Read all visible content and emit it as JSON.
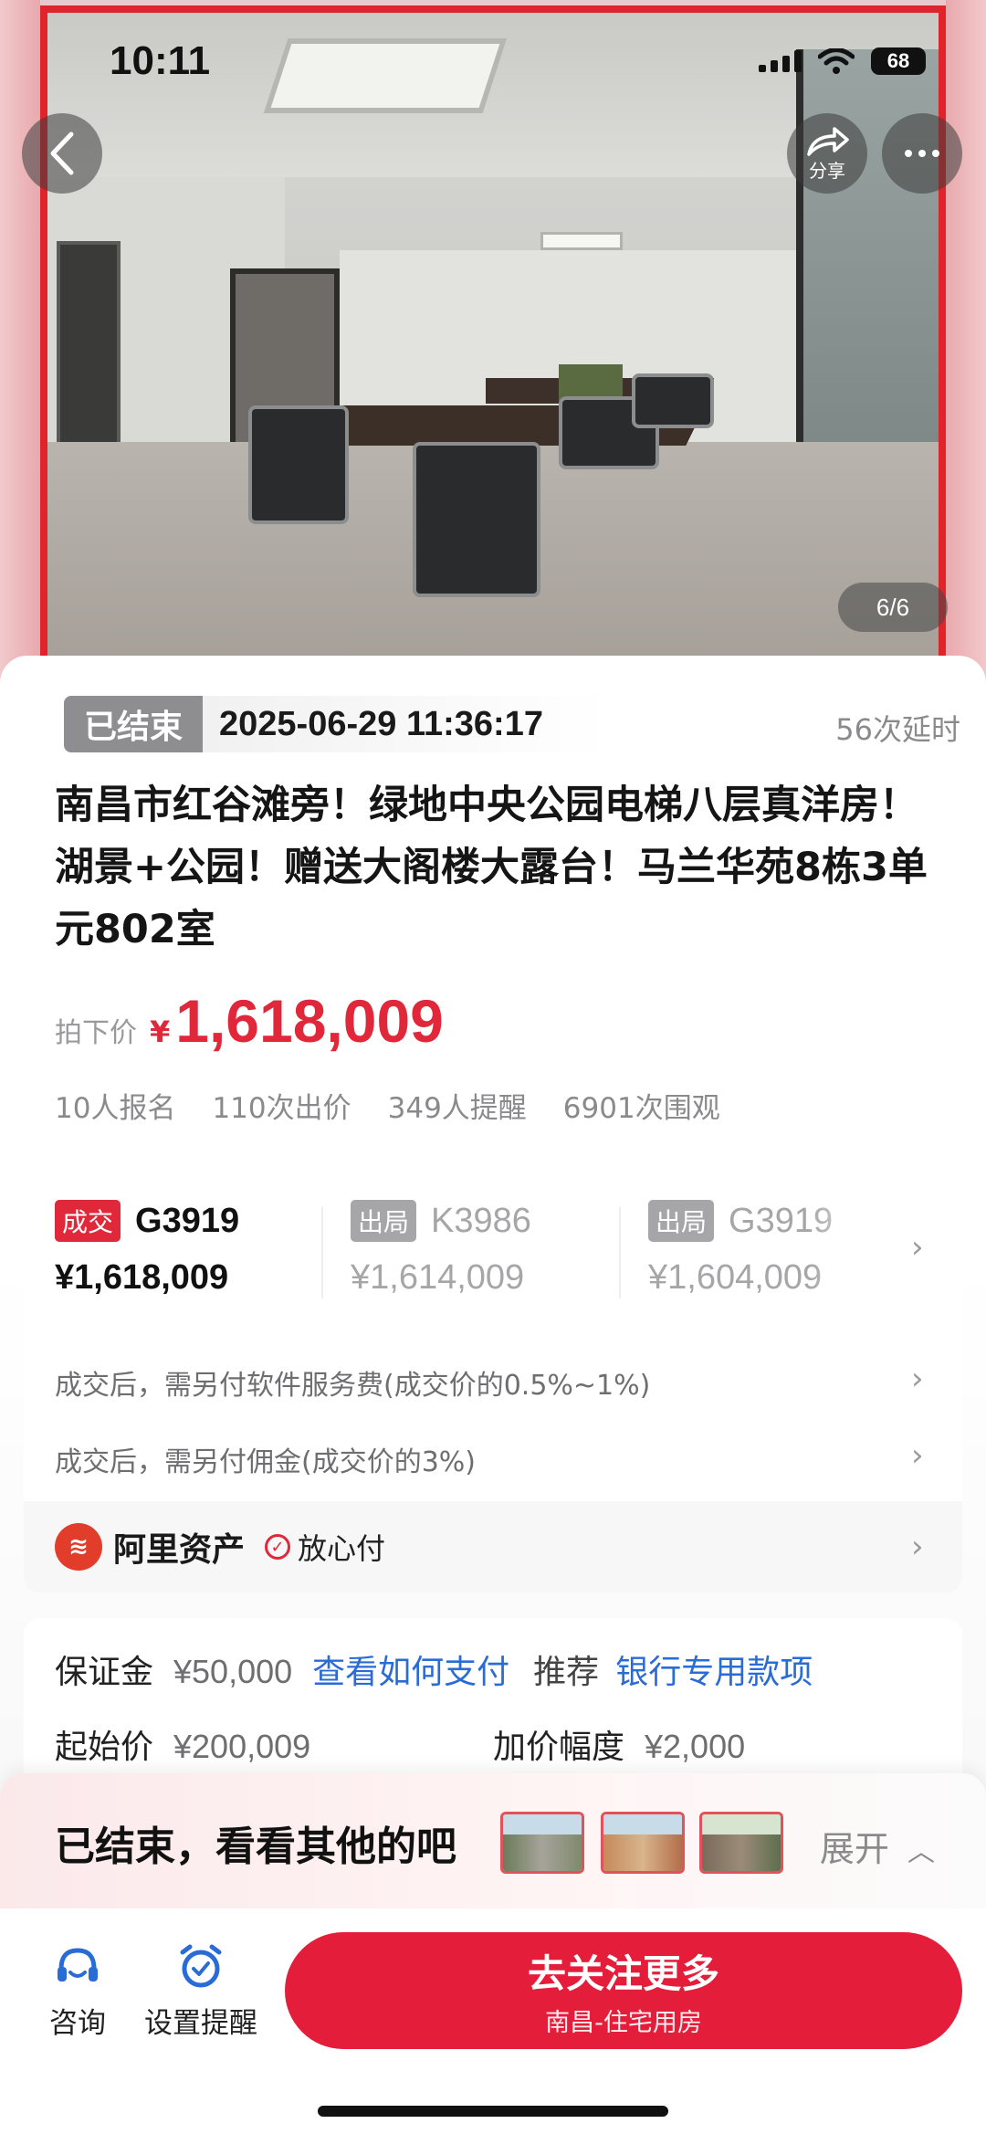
{
  "status_bar": {
    "time": "10:11",
    "battery": "68"
  },
  "gallery": {
    "share_label": "分享",
    "pager": "6/6"
  },
  "auction": {
    "status": "已结束",
    "end_time": "2025-06-29 11:36:17",
    "delay_count": "56次延时",
    "title": "南昌市红谷滩旁！绿地中央公园电梯八层真洋房！湖景+公园！赠送大阁楼大露台！马兰华苑8栋3单元802室",
    "price_label": "拍下价",
    "price_symbol": "¥",
    "price": "1,618,009",
    "stats": [
      "10人报名",
      "110次出价",
      "349人提醒",
      "6901次围观"
    ]
  },
  "bids": [
    {
      "tag": "成交",
      "code": "G3919",
      "amount": "¥1,618,009"
    },
    {
      "tag": "出局",
      "code": "K3986",
      "amount": "¥1,614,009"
    },
    {
      "tag": "出局",
      "code": "G3919",
      "amount": "¥1,604,009"
    }
  ],
  "fees": {
    "service": "成交后，需另付软件服务费(成交价的0.5%~1%)",
    "commission": "成交后，需另付佣金(成交价的3%)"
  },
  "platform": {
    "name": "阿里资产",
    "badge": "放心付"
  },
  "deposit": {
    "label": "保证金",
    "value": "¥50,000",
    "how_to_pay": "查看如何支付",
    "recommend_label": "推荐",
    "recommend_link": "银行专用款项",
    "start_label": "起始价",
    "start_value": "¥200,009",
    "increment_label": "加价幅度",
    "increment_value": "¥2,000"
  },
  "ended_panel": {
    "text": "已结束，看看其他的吧",
    "expand": "展开"
  },
  "action_bar": {
    "consult": "咨询",
    "reminder": "设置提醒",
    "cta_main": "去关注更多",
    "cta_sub": "南昌-住宅用房"
  },
  "colors": {
    "accent": "#e41e3a",
    "link": "#2a6cd6",
    "muted": "#8a8a8c"
  },
  "icons": [
    "back-arrow-icon",
    "share-icon",
    "more-icon",
    "chevron-right-icon",
    "alipay-asset-logo",
    "check-circle-icon",
    "headset-icon",
    "alarm-clock-icon",
    "chevron-up-icon"
  ]
}
